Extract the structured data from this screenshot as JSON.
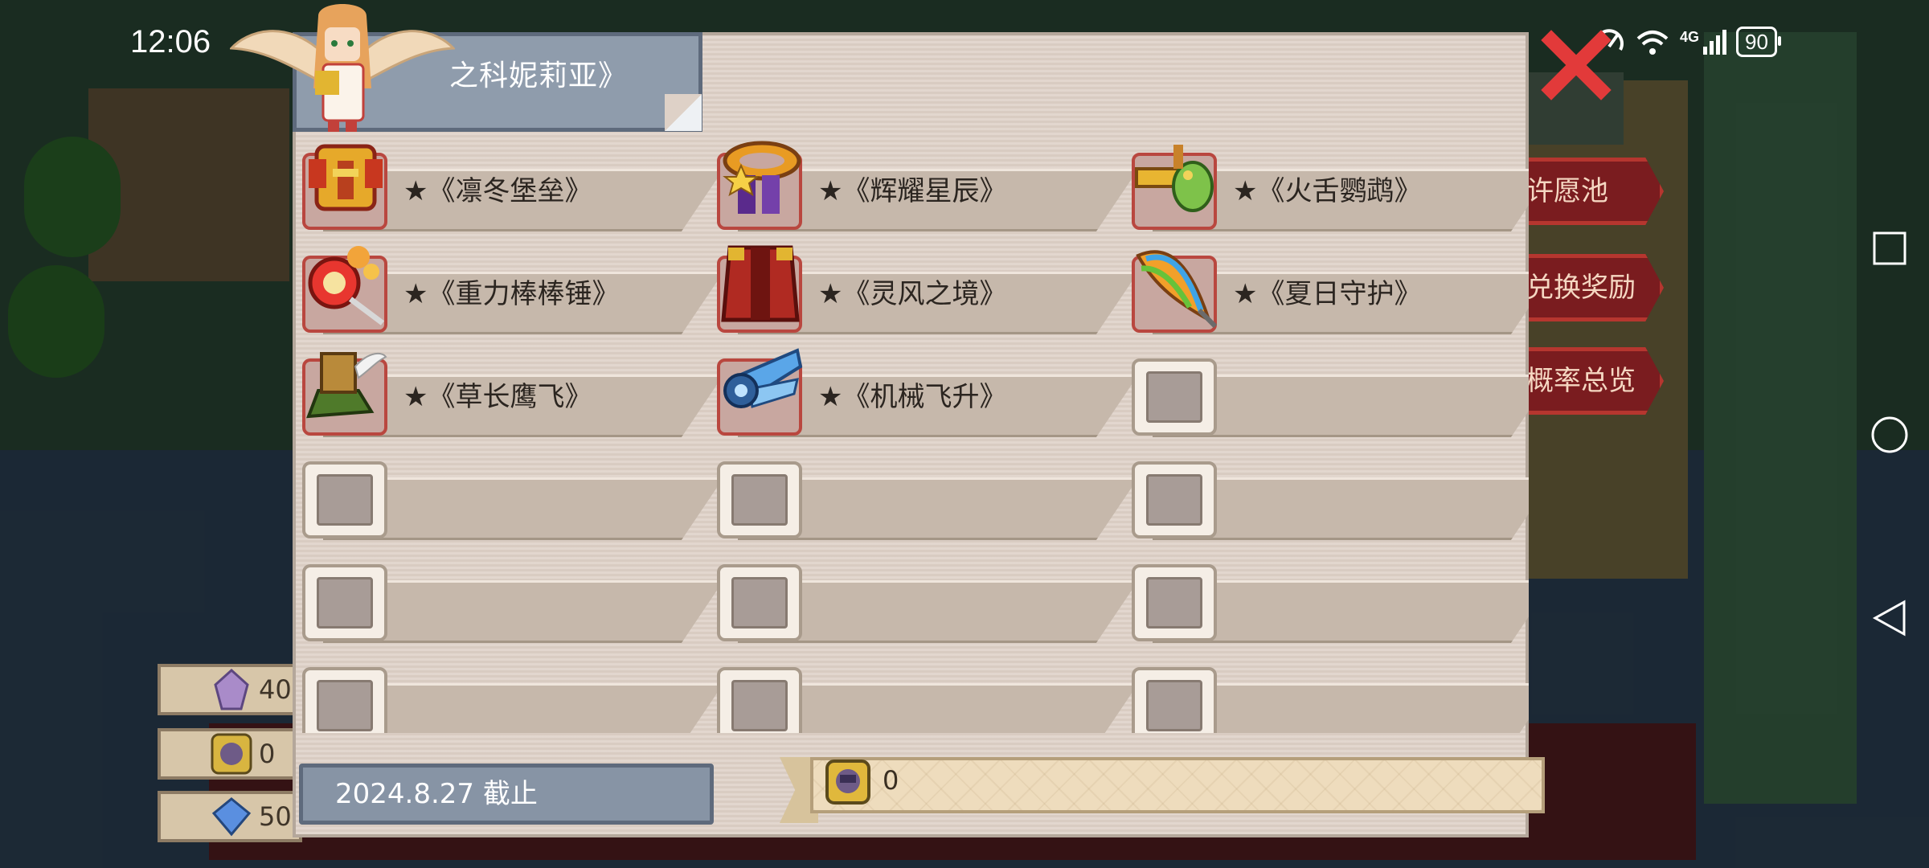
{
  "status_bar": {
    "time": "12:06",
    "network": "4G",
    "battery": "90"
  },
  "dialog": {
    "title": "之科妮莉亚》",
    "deadline": "2024.8.27 截止",
    "token_count": "0"
  },
  "items": [
    {
      "name": "★《凛冬堡垒》",
      "icon": "golden-armor-icon"
    },
    {
      "name": "★《辉耀星辰》",
      "icon": "star-scarf-icon"
    },
    {
      "name": "★《火舌鹦鹉》",
      "icon": "parrot-gun-icon"
    },
    {
      "name": "★《重力棒棒锤》",
      "icon": "lollipop-hammer-icon"
    },
    {
      "name": "★《灵风之境》",
      "icon": "red-cape-icon"
    },
    {
      "name": "★《夏日守护》",
      "icon": "rainbow-blade-icon"
    },
    {
      "name": "★《草长鹰飞》",
      "icon": "winged-boot-icon"
    },
    {
      "name": "★《机械飞升》",
      "icon": "mech-wing-icon"
    }
  ],
  "background": {
    "side_buttons": [
      "许愿池",
      "兑换奖励",
      "概率总览"
    ],
    "currencies": [
      {
        "icon": "crystal-icon",
        "value": "40"
      },
      {
        "icon": "token-icon",
        "value": "0"
      },
      {
        "icon": "diamond-icon",
        "value": "50"
      }
    ]
  },
  "colors": {
    "panel": "#ded1c7",
    "banner": "#8f9cac",
    "slot_bar": "#c6b8ab",
    "highlight_frame": "#b9473f",
    "close": "#e23a3a"
  }
}
